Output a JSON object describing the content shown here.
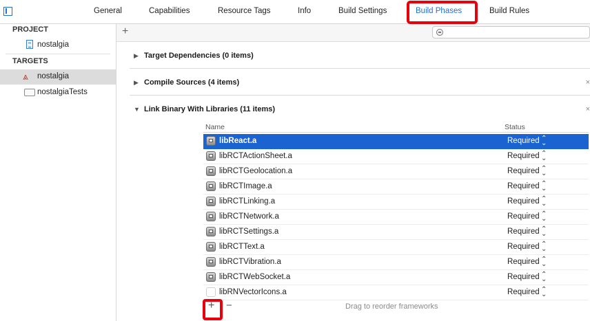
{
  "tabs": [
    {
      "label": "General"
    },
    {
      "label": "Capabilities"
    },
    {
      "label": "Resource Tags"
    },
    {
      "label": "Info"
    },
    {
      "label": "Build Settings"
    },
    {
      "label": "Build Phases",
      "active": true
    },
    {
      "label": "Build Rules"
    }
  ],
  "sidebar": {
    "project_header": "PROJECT",
    "project_item": "nostalgia",
    "targets_header": "TARGETS",
    "targets": [
      {
        "label": "nostalgia",
        "icon": "app-target-icon",
        "selected": true
      },
      {
        "label": "nostalgiaTests",
        "icon": "folder-icon"
      }
    ]
  },
  "phases": {
    "target_dependencies": "Target Dependencies (0 items)",
    "compile_sources": "Compile Sources (4 items)",
    "link_binary": "Link Binary With Libraries (11 items)"
  },
  "libraries": {
    "header_name": "Name",
    "header_status": "Status",
    "rows": [
      {
        "name": "libReact.a",
        "status": "Required"
      },
      {
        "name": "libRCTActionSheet.a",
        "status": "Required"
      },
      {
        "name": "libRCTGeolocation.a",
        "status": "Required"
      },
      {
        "name": "libRCTImage.a",
        "status": "Required"
      },
      {
        "name": "libRCTLinking.a",
        "status": "Required"
      },
      {
        "name": "libRCTNetwork.a",
        "status": "Required"
      },
      {
        "name": "libRCTSettings.a",
        "status": "Required"
      },
      {
        "name": "libRCTText.a",
        "status": "Required"
      },
      {
        "name": "libRCTVibration.a",
        "status": "Required"
      },
      {
        "name": "libRCTWebSocket.a",
        "status": "Required"
      },
      {
        "name": "libRNVectorIcons.a",
        "status": "Required"
      }
    ],
    "footer_hint": "Drag to reorder frameworks"
  },
  "colors": {
    "accent": "#1f6fd6",
    "selection": "#1a63d1",
    "highlight_box": "#e8000b"
  }
}
